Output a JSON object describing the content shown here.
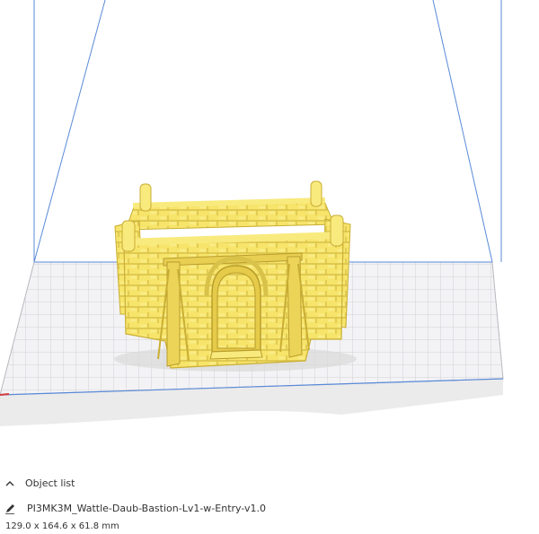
{
  "app": {
    "view": "3d-build-plate"
  },
  "colors": {
    "model": "#f7e46a",
    "plate_grid": "#c9c9cf",
    "build_volume_line": "#5a8ad8",
    "shadow": "#d8d8d8"
  },
  "object_list": {
    "toggle_label": "Object list",
    "toggle_icon": "chevron-up-icon",
    "edit_icon": "pencil-icon",
    "object_name": "PI3MK3M_Wattle-Daub-Bastion-Lv1-w-Entry-v1.0",
    "dimensions": "129.0 x 164.6 x 61.8 mm"
  }
}
